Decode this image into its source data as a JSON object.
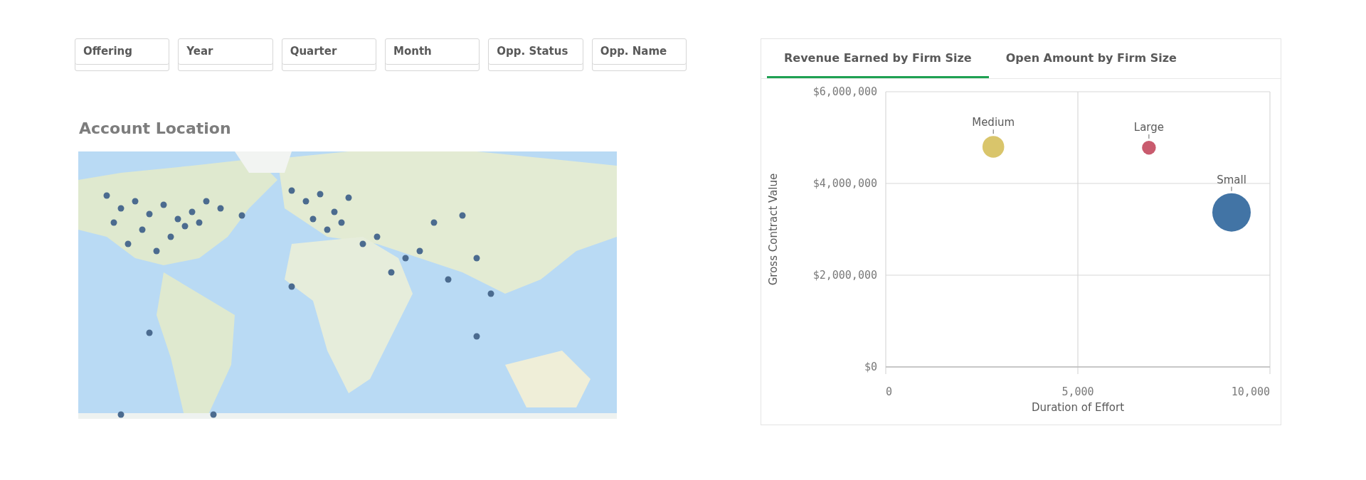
{
  "filters": [
    {
      "label": "Offering"
    },
    {
      "label": "Year"
    },
    {
      "label": "Quarter"
    },
    {
      "label": "Month"
    },
    {
      "label": "Opp. Status"
    },
    {
      "label": "Opp. Name"
    }
  ],
  "map_section": {
    "title": "Account Location"
  },
  "chart_panel": {
    "tabs": [
      {
        "label": "Revenue Earned by Firm Size",
        "selected": true
      },
      {
        "label": "Open Amount by Firm Size",
        "selected": false
      }
    ],
    "chart_data": {
      "type": "scatter",
      "xlabel": "Duration of Effort",
      "ylabel": "Gross Contract Value",
      "x": [
        2800,
        6850,
        9000
      ],
      "series": [
        {
          "name": "Medium",
          "color": "#d9c56b",
          "sizes": [
            0.32,
            null,
            null
          ],
          "values": [
            4800000,
            null,
            null
          ]
        },
        {
          "name": "Large",
          "color": "#c95b6e",
          "sizes": [
            null,
            0.13,
            null
          ],
          "values": [
            null,
            4780000,
            null
          ]
        },
        {
          "name": "Small",
          "color": "#4274a5",
          "sizes": [
            null,
            null,
            1
          ],
          "values": [
            null,
            null,
            3370000
          ]
        }
      ],
      "xlim": [
        0,
        10000
      ],
      "ylim": [
        0,
        6000000
      ],
      "xticks": [
        {
          "value": 0,
          "label": "0"
        },
        {
          "value": 5000,
          "label": "5,000"
        },
        {
          "value": 10000,
          "label": "10,000"
        }
      ],
      "yticks": [
        {
          "value": 0,
          "label": "$0"
        },
        {
          "value": 2000000,
          "label": "$2,000,000"
        },
        {
          "value": 4000000,
          "label": "$4,000,000"
        },
        {
          "value": 6000000,
          "label": "$6,000,000"
        }
      ],
      "grid": true
    }
  }
}
